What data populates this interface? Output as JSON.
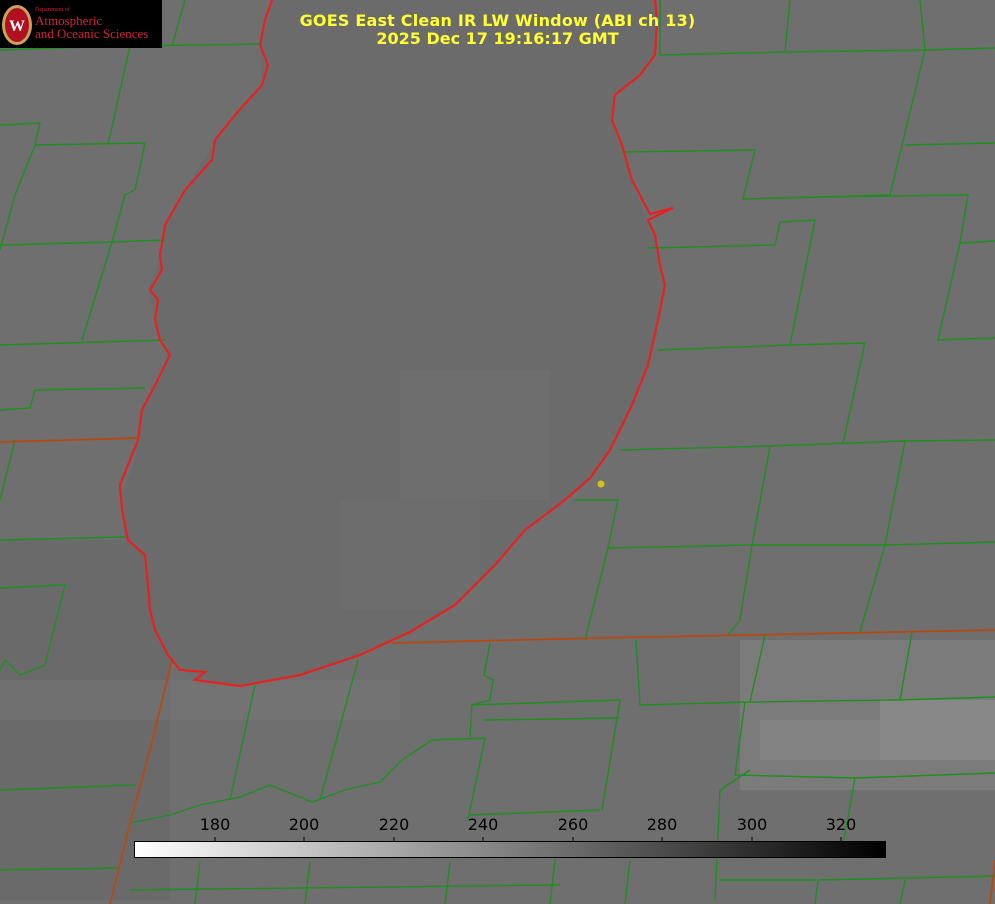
{
  "logo": {
    "dept_line": "Department of",
    "line1": "Atmospheric",
    "line2": "and Oceanic Sciences",
    "crest_letter": "W"
  },
  "title": {
    "line1": "GOES East Clean IR LW Window (ABI ch 13)",
    "line2": "2025 Dec 17 19:16:17 GMT"
  },
  "colorbar": {
    "ticks": [
      "180",
      "200",
      "220",
      "240",
      "260",
      "280",
      "300",
      "320"
    ],
    "range": "white (cold) to black (warm)"
  },
  "colors": {
    "background": "#6e6e6e",
    "lake": "#6a6a6a",
    "county_lines": "#1f8f1f",
    "coastline": "#e82020",
    "state_lines": "#b54a12",
    "title_text": "#ffff33",
    "logo_accent": "#d4233a"
  },
  "map": {
    "feature": "lake outline with county boundaries",
    "marker": "yellow-dot"
  }
}
